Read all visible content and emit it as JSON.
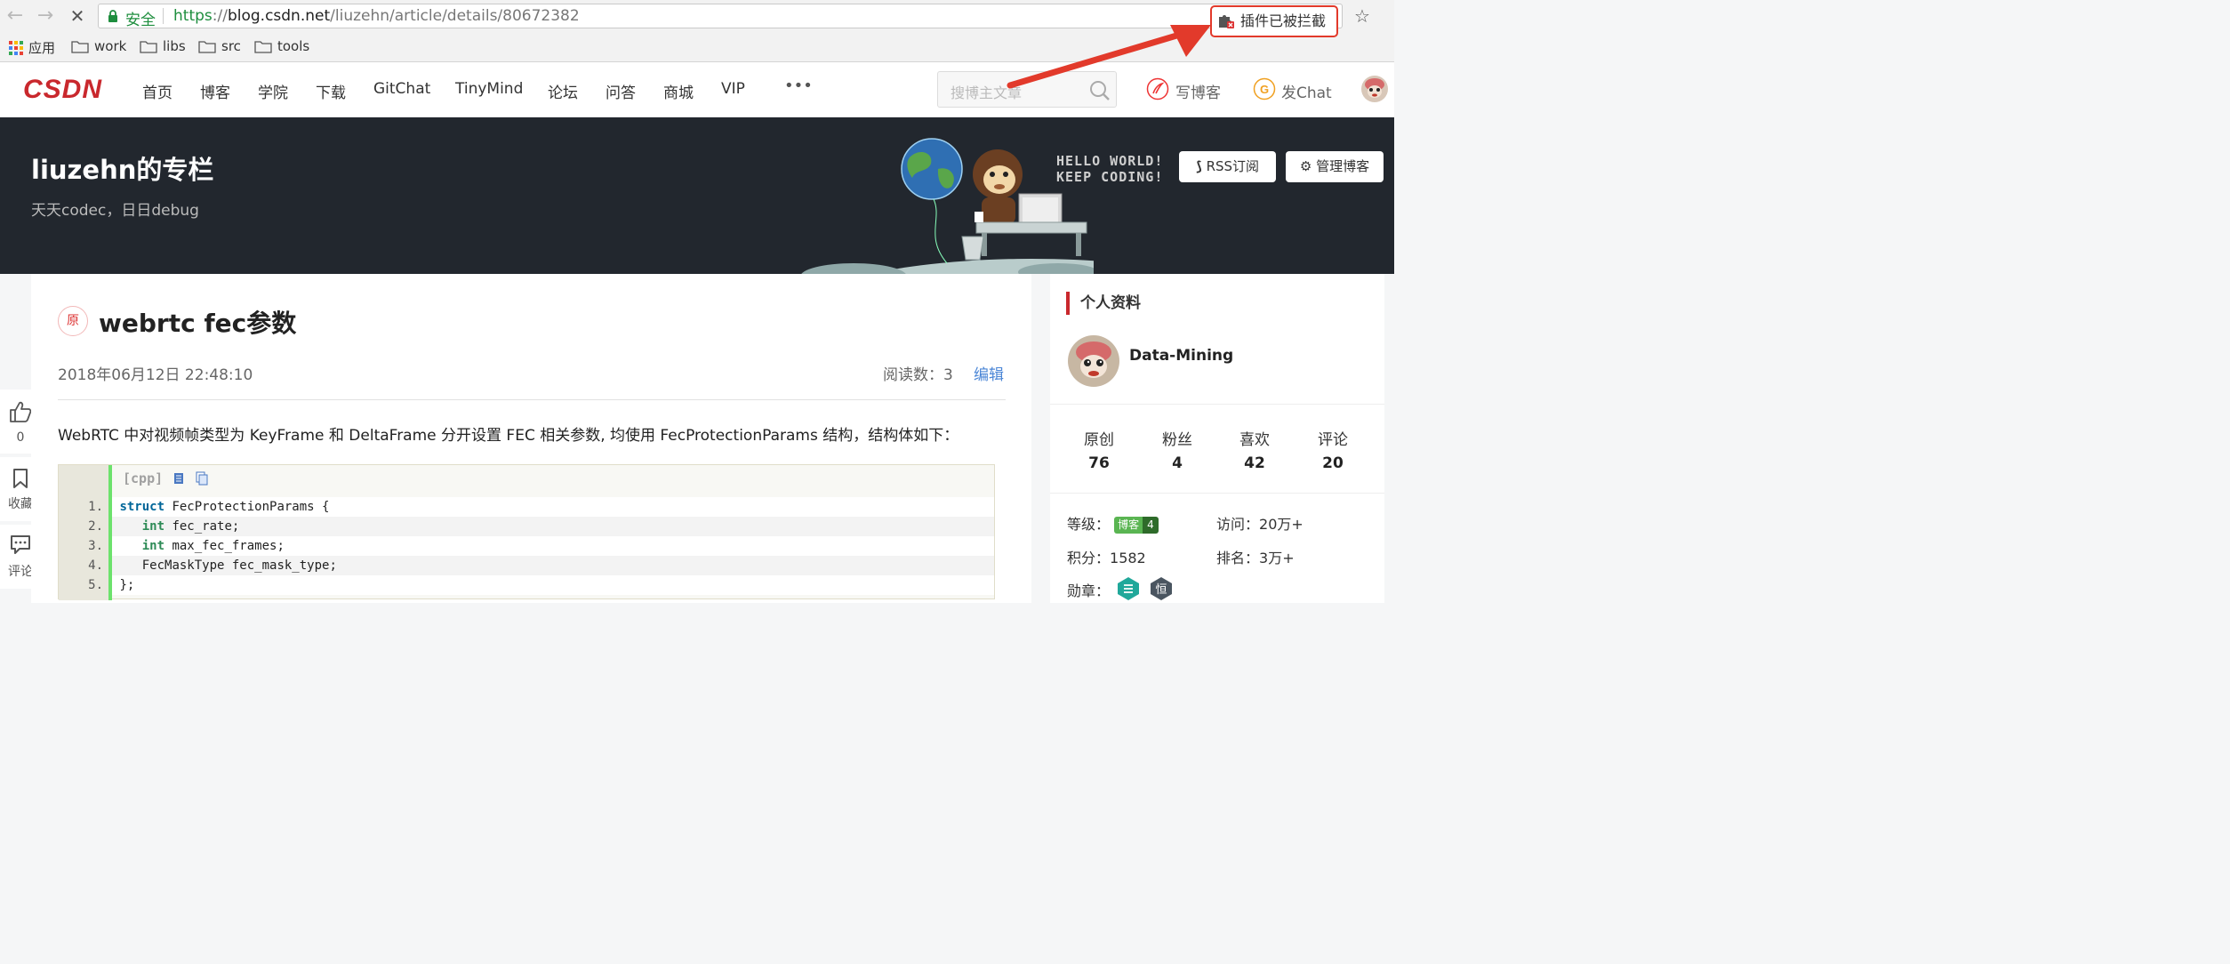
{
  "browser": {
    "back_icon": "←",
    "forward_icon": "→",
    "reload_icon": "✕",
    "secure_label": "安全",
    "url_scheme": "https",
    "url_sep": "://",
    "url_domain": "blog.csdn.net",
    "url_path": "/liuzehn/article/details/80672382",
    "plugin_blocked": "插件已被拦截",
    "star_icon": "☆",
    "bookmarks": [
      "应用",
      "work",
      "libs",
      "src",
      "tools"
    ]
  },
  "toolbar": {
    "logo": "CSDN",
    "nav": [
      "首页",
      "博客",
      "学院",
      "下载",
      "GitChat",
      "TinyMind",
      "论坛",
      "问答",
      "商城",
      "VIP"
    ],
    "more": "•••",
    "search_placeholder": "搜博主文章",
    "write_blog": "写博客",
    "post_chat": "发Chat"
  },
  "banner": {
    "title": "liuzehn的专栏",
    "subtitle": "天天codec，日日debug",
    "hello_line1": "HELLO WORLD!",
    "hello_line2": "KEEP CODING!",
    "rss": "RSS订阅",
    "manage": "管理博客"
  },
  "float_bar": {
    "like_count": "0",
    "collect": "收藏",
    "comment": "评论"
  },
  "article": {
    "badge": "原",
    "title": "webrtc fec参数",
    "date": "2018年06月12日 22:48:10",
    "read_label": "阅读数：",
    "read_count": "3",
    "edit": "编辑",
    "paragraph": "WebRTC 中对视频帧类型为 KeyFrame 和 DeltaFrame 分开设置 FEC 相关参数, 均使用 FecProtectionParams 结构，结构体如下：",
    "code_lang": "[cpp]",
    "code_lines": [
      {
        "n": "1.",
        "kw": "struct",
        "rest": " FecProtectionParams {"
      },
      {
        "n": "2.",
        "kw": "   int",
        "rest": " fec_rate;"
      },
      {
        "n": "3.",
        "kw": "   int",
        "rest": " max_fec_frames;"
      },
      {
        "n": "4.",
        "kw": "",
        "rest": "   FecMaskType fec_mask_type;"
      },
      {
        "n": "5.",
        "kw": "",
        "rest": "};"
      }
    ]
  },
  "sidebar": {
    "header": "个人资料",
    "username": "Data-Mining",
    "stats": [
      {
        "label": "原创",
        "value": "76"
      },
      {
        "label": "粉丝",
        "value": "4"
      },
      {
        "label": "喜欢",
        "value": "42"
      },
      {
        "label": "评论",
        "value": "20"
      }
    ],
    "level_label": "等级：",
    "level_badge_text": "博客",
    "level_badge_num": "4",
    "visits_label": "访问：",
    "visits": "20万+",
    "points_label": "积分：",
    "points": "1582",
    "rank_label": "排名：",
    "rank": "3万+",
    "medals_label": "勋章：",
    "medal_2": "恒"
  },
  "colors": {
    "csdn_red": "#c9282d",
    "banner_bg": "#22272e",
    "annotation_red": "#e23a2b",
    "edit_blue": "#4b86d6"
  }
}
